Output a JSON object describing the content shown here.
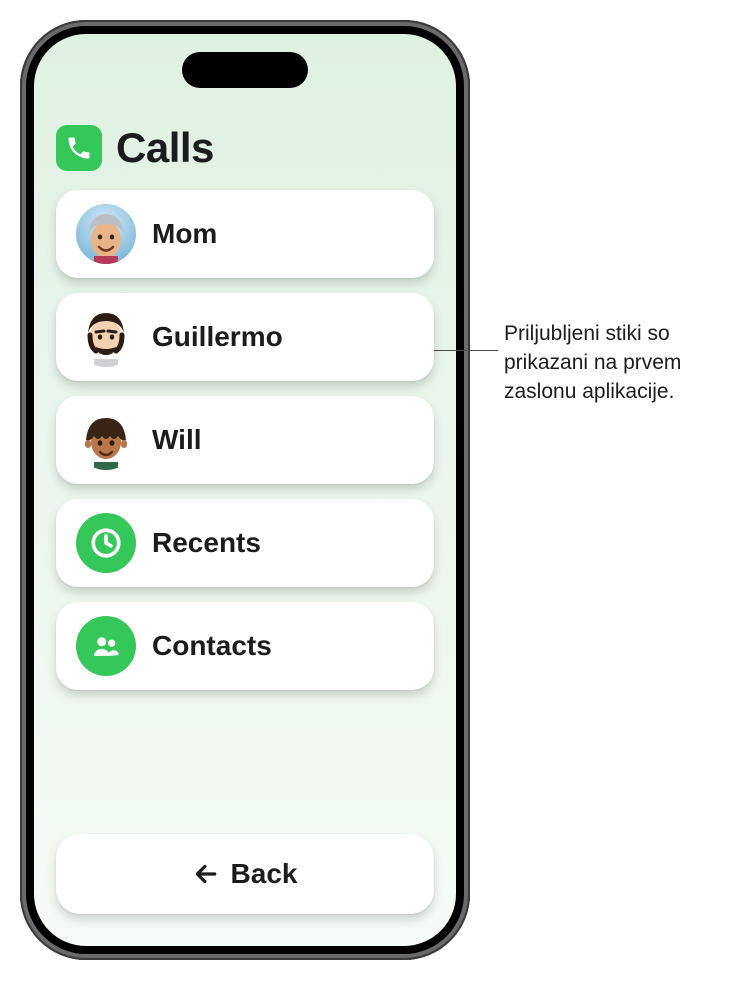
{
  "header": {
    "title": "Calls",
    "icon": "phone-icon"
  },
  "accent_color": "#35c759",
  "contacts": [
    {
      "name": "Mom",
      "avatar": "memoji-mom"
    },
    {
      "name": "Guillermo",
      "avatar": "memoji-guillermo"
    },
    {
      "name": "Will",
      "avatar": "memoji-will"
    }
  ],
  "menu": [
    {
      "label": "Recents",
      "icon": "clock-icon"
    },
    {
      "label": "Contacts",
      "icon": "people-icon"
    }
  ],
  "back": {
    "label": "Back",
    "icon": "arrow-left-icon"
  },
  "callout": {
    "text": "Priljubljeni stiki so prikazani na prvem zaslonu aplikacije."
  }
}
